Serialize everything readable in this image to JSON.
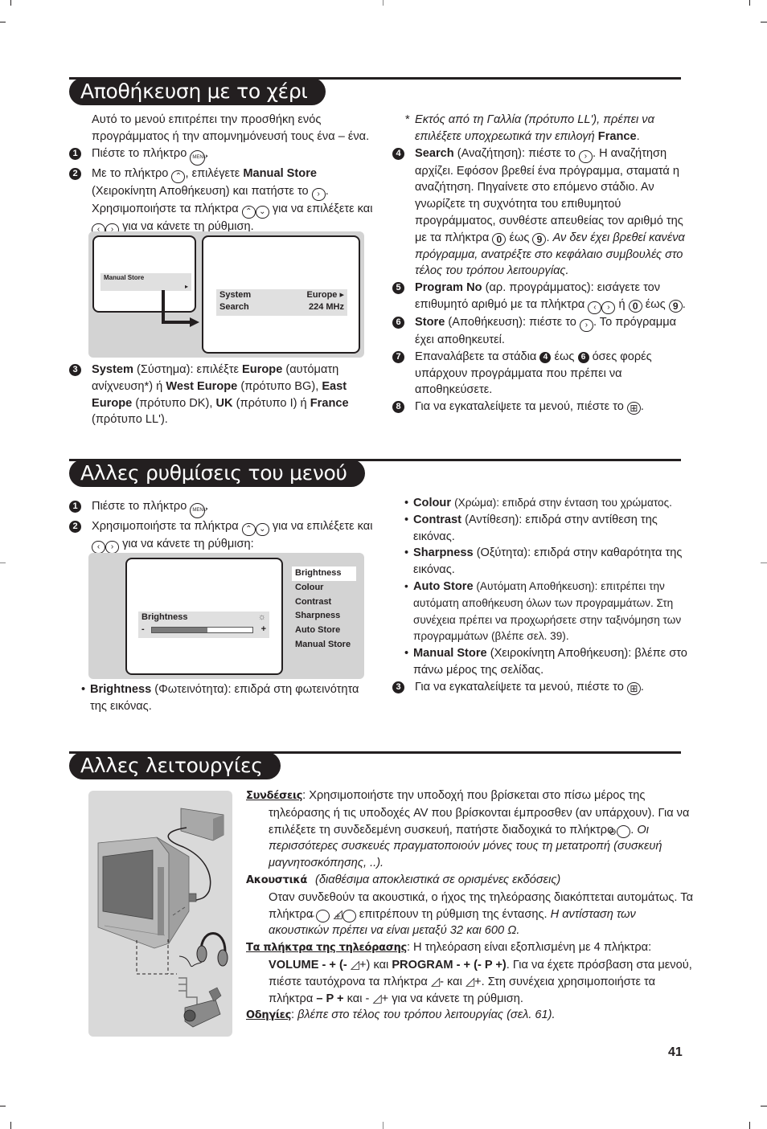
{
  "page_number": "41",
  "sections": {
    "manual_store": {
      "title": "Αποθήκευση με το χέρι",
      "intro": "Αυτό το μενού επιτρέπει την προσθήκη ενός προγράμματος ή την απομνημόνευσή τους ένα – ένα.",
      "step1": {
        "num": "1",
        "text": "Πιέστε το πλήκτρο",
        "key": "MENU"
      },
      "step2": {
        "num": "2",
        "t1": "Με το πλήκτρο",
        "t2": ", επιλέγετε",
        "b1": "Manual Store",
        "t3": "(Χειροκίνητη Αποθήκευση) και πατήστε το",
        "t4": ". Χρησιμοποιήστε τα πλήκτρα",
        "t5": "για να επιλέξετε και",
        "t6": "για να κάνετε τη ρύθμιση."
      },
      "osd_left": {
        "label": "Manual Store",
        "arrow": "▸"
      },
      "osd_right": {
        "rows": [
          {
            "label": "System",
            "value": "Europe ▸"
          },
          {
            "label": "Search",
            "value": "224 MHz"
          }
        ]
      },
      "step3": {
        "num": "3",
        "b_system": "System",
        "t1": "(Σύστημα): επιλέξτε",
        "b_europe": "Europe",
        "t2": "(αυτόματη ανίχνευση*) ή",
        "b_west": "West Europe",
        "t3": "(πρότυπο BG),",
        "b_east": "East Europe",
        "t4": "(πρότυπο DK),",
        "b_uk": "UK",
        "t5": "(πρότυπο I) ή",
        "b_france": "France",
        "t6": "(πρότυπο LL')."
      },
      "footnote": {
        "star": "*",
        "text": "Εκτός από τη Γαλλία (πρότυπο LL'), πρέπει να επιλέξετε υποχρεωτικά την επιλογή",
        "b": "France",
        "end": "."
      },
      "step4": {
        "num": "4",
        "b": "Search",
        "t1": "(Αναζήτηση): πιέστε το",
        "t2": ". Η αναζήτηση αρχίζει. Εφόσον βρεθεί ένα πρόγραμμα, σταματά η αναζήτηση. Πηγαίνετε στο επόμενο στάδιο. Αν γνωρίζετε τη συχνότητα του επιθυμητού προγράμματος, συνθέστε απευθείας τον αριθμό της με τα πλήκτρα",
        "k0": "0",
        "t3": "έως",
        "k9": "9",
        "t4": ".",
        "italic": "Αν δεν έχει βρεθεί κανένα πρόγραμμα, ανατρέξτε στο κεφάλαιο συμβουλές στο τέλος του τρόπου λειτουργίας."
      },
      "step5": {
        "num": "5",
        "b": "Program No",
        "t1": "(αρ. προγράμματος): εισάγετε τον επιθυμητό αριθμό με τα πλήκτρα",
        "t2": "ή",
        "k0": "0",
        "t3": "έως",
        "k9": "9",
        "t4": "."
      },
      "step6": {
        "num": "6",
        "b": "Store",
        "t1": "(Αποθήκευση): πιέστε το",
        "t2": ". Το πρόγραμμα έχει αποθηκευτεί."
      },
      "step7": {
        "num": "7",
        "t1": "Επαναλάβετε τα στάδια",
        "n4": "4",
        "t2": "έως",
        "n6": "6",
        "t3": "όσες φορές υπάρχουν προγράμματα που πρέπει να αποθηκεύσετε."
      },
      "step8": {
        "num": "8",
        "t1": "Για να εγκαταλείψετε τα μενού, πιέστε το",
        "t2": "."
      }
    },
    "other_menu": {
      "title": "Αλλες ρυθμίσεις του μενού",
      "step1": {
        "num": "1",
        "text": "Πιέστε το πλήκτρο",
        "key": "MENU"
      },
      "step2": {
        "num": "2",
        "t1": "Χρησιμοποιήστε τα πλήκτρα",
        "t2": "για να επιλέξετε και",
        "t3": "για να κάνετε τη ρύθμιση:"
      },
      "osd": {
        "slider_label": "Brightness",
        "minus": "-",
        "plus": "+",
        "brightness_level": 0.55,
        "menu_items": [
          "Brightness",
          "Colour",
          "Contrast",
          "Sharpness",
          "Auto Store",
          "Manual Store"
        ],
        "selected_index": 0
      },
      "bullets": [
        {
          "b": "Brightness",
          "t": "(Φωτεινότητα): επιδρά στη φωτεινότητα της εικόνας."
        },
        {
          "b": "Colour",
          "t": "(Χρώμα): επιδρά στην ένταση του χρώματος."
        },
        {
          "b": "Contrast",
          "t": "(Αντίθεση): επιδρά στην αντίθεση της εικόνας."
        },
        {
          "b": "Sharpness",
          "t": "(Οξύτητα): επιδρά στην καθαρότητα της εικόνας."
        },
        {
          "b": "Auto Store",
          "t": "(Αυτόματη Αποθήκευση): επιτρέπει την αυτόματη αποθήκευση όλων των προγραμμάτων. Στη συνέχεια πρέπει να προχωρήσετε στην ταξινόμηση των προγραμμάτων (βλέπε σελ. 39)."
        },
        {
          "b": "Manual Store",
          "t": "(Χειροκίνητη Αποθήκευση): βλέπε στο πάνω μέρος της σελίδας."
        }
      ],
      "step3": {
        "num": "3",
        "t1": "Για να εγκαταλείψετε τα μενού, πιέστε το",
        "t2": "."
      }
    },
    "other_functions": {
      "title": "Αλλες λειτουργίες",
      "connections": {
        "label": "Συνδέσεις",
        "t1": ": Χρησιμοποιήστε την υποδοχή που βρίσκεται στο πίσω μέρος της τηλεόρασης ή τις υποδοχές AV που βρίσκονται έμπροσθεν (αν υπάρχουν). Για να επιλέξετε τη συνδεδεμένη συσκευή, πατήστε διαδοχικά το πλήκτρο",
        "t2": ".",
        "italic": "Οι περισσότερες συσκευές πραγματοποιούν μόνες τους τη μετατροπή (συσκευή μαγνητοσκόπησης, ..)."
      },
      "headphones": {
        "label": "Ακουστικά",
        "italic_note": "(διαθέσιμα αποκλειστικά σε ορισμένες εκδόσεις)",
        "t1": "Οταν συνδεθούν τα ακουστικά, ο ήχος της τηλεόρασης διακόπτεται αυτομάτως. Τα πλήκτρα",
        "t2": "επιτρέπουν τη ρύθμιση της έντασης.",
        "italic": "Η αντίσταση των ακουστικών πρέπει να είναι μεταξύ 32 και 600 Ω."
      },
      "tv_keys": {
        "label": "Τα πλήκτρα της τηλεόρασης",
        "t1": ": Η τηλεόραση είναι εξοπλισμένη με 4 πλήκτρα:",
        "b_volume": "VOLUME - + (-",
        "b_volume_end": "+)",
        "t2": "και",
        "b_program": "PROGRAM - + (- P +)",
        "t3": ". Για να έχετε πρόσβαση στα μενού, πιέστε ταυτόχρονα τα πλήκτρα",
        "t4": "- και",
        "t5": "+. Στη συνέχεια χρησιμοποιήστε τα πλήκτρα",
        "b_p": "– P +",
        "t6": "και -",
        "t7": "+ για να κάνετε τη ρύθμιση."
      },
      "instructions": {
        "label": "Οδηγίες",
        "italic": "βλέπε στο τέλος του τρόπου λειτουργίας (σελ. 61)."
      }
    }
  },
  "icons": {
    "menu_key": "MENU",
    "up": "⌃",
    "down": "⌄",
    "left": "‹",
    "right": "›",
    "exit": "⊞",
    "av": "⊖",
    "minus": "−",
    "plus": "+",
    "volume": "◿",
    "sun": "☼"
  }
}
